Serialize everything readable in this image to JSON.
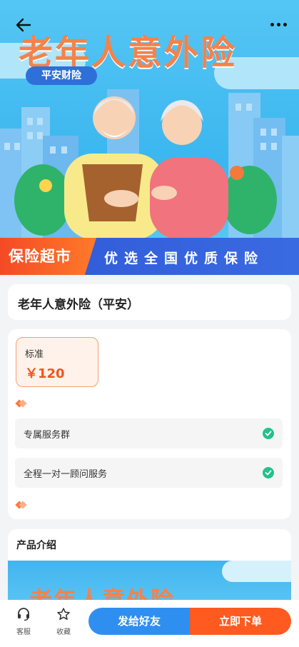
{
  "hero": {
    "title": "老年人意外险",
    "brand": "平安财险",
    "banner_left": "保险超市",
    "banner_right": "优选全国优质保险"
  },
  "product": {
    "title": "老年人意外险（平安）"
  },
  "plan": {
    "name": "标准",
    "price": "￥120"
  },
  "features": [
    {
      "label": "专属服务群"
    },
    {
      "label": "全程一对一顾问服务"
    }
  ],
  "intro": {
    "heading": "产品介绍",
    "image_text": "老年人意外险"
  },
  "bottom": {
    "service_label": "客服",
    "favorite_label": "收藏",
    "share_label": "发给好友",
    "buy_label": "立即下单"
  },
  "colors": {
    "accent_orange": "#ff5a1f",
    "accent_blue": "#2f8ff0",
    "check_green": "#22c28d"
  }
}
